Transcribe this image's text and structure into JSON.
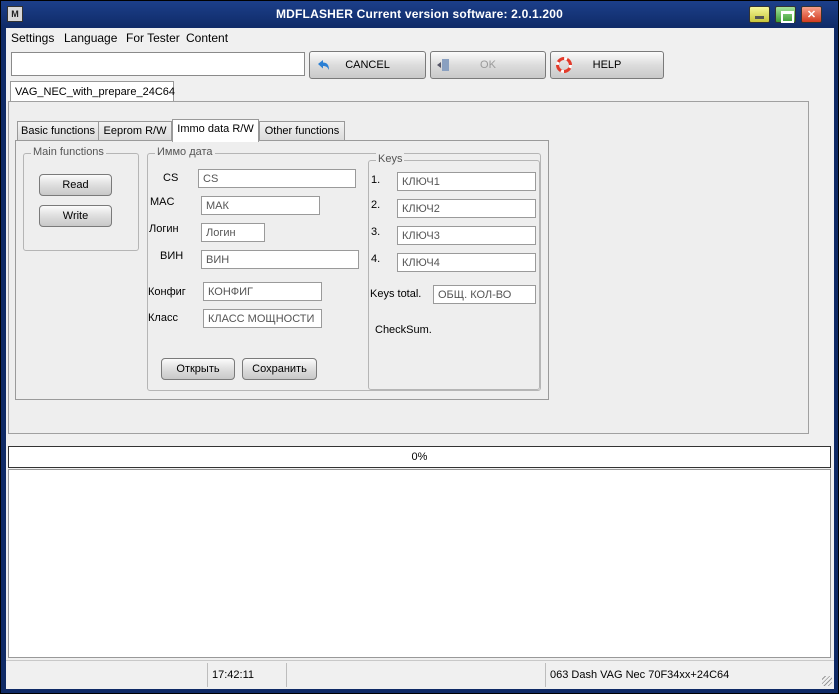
{
  "window": {
    "title": "MDFLASHER  Current version software: 2.0.1.200",
    "icon": "app-logo-icon"
  },
  "menu": [
    "Settings",
    "Language",
    "For Tester",
    "Content"
  ],
  "toolbar": {
    "command_value": "",
    "cancel_label": "CANCEL",
    "ok_label": "OK",
    "help_label": "HELP"
  },
  "document_tab": "VAG_NEC_with_prepare_24C64",
  "tabs": [
    "Basic functions",
    "Eeprom R/W",
    "Immo data R/W",
    "Other functions"
  ],
  "active_tab": "Immo data R/W",
  "main_functions": {
    "title": "Main functions",
    "read": "Read",
    "write": "Write"
  },
  "immo": {
    "title": "Иммо дата",
    "cs_label": "CS",
    "cs_value": "CS",
    "mac_label": "MAC",
    "mac_value": "МАК",
    "login_label": "Логин",
    "login_value": "Логин",
    "vin_label": "ВИН",
    "vin_value": "ВИН",
    "config_label": "Конфиг",
    "config_value": "КОНФИГ",
    "class_label": "Класс",
    "class_value": "КЛАСС МОЩНОСТИ",
    "open_label": "Открыть",
    "save_label": "Сохранить"
  },
  "keys": {
    "title": "Keys",
    "items": [
      {
        "num": "1.",
        "value": "КЛЮЧ1"
      },
      {
        "num": "2.",
        "value": "КЛЮЧ2"
      },
      {
        "num": "3.",
        "value": "КЛЮЧ3"
      },
      {
        "num": "4.",
        "value": "КЛЮЧ4"
      }
    ],
    "total_label": "Keys total.",
    "total_value": "ОБЩ. КОЛ-ВО",
    "checksum_label": "CheckSum."
  },
  "progress": {
    "percent": 0,
    "label": "0%"
  },
  "status": {
    "time": "17:42:11",
    "device": "063 Dash VAG Nec 70F34xx+24C64"
  },
  "colors": {
    "title_bar": "#0f2a66",
    "client_bg": "#f0f0f0",
    "progress_fill": "#3b8e3b"
  }
}
